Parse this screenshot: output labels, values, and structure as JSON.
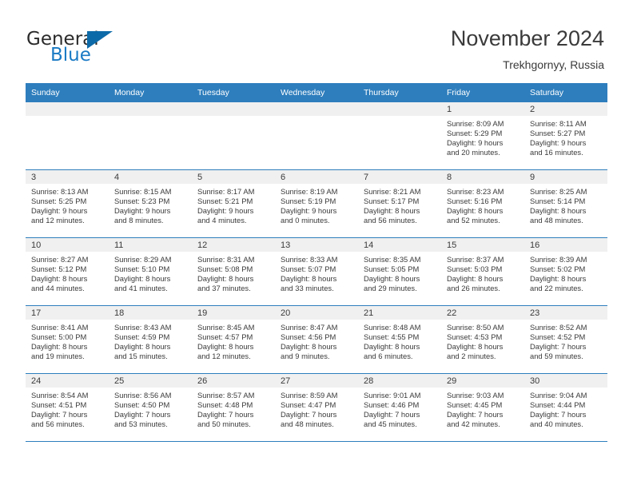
{
  "brand": {
    "word1": "General",
    "word2": "Blue",
    "accent_color": "#1a7ac4",
    "triangle_color": "#0d6aa8"
  },
  "header": {
    "title": "November 2024",
    "subtitle": "Trekhgornyy, Russia"
  },
  "calendar": {
    "header_color": "#2e7ebd",
    "daynum_band_color": "#f0f0f0",
    "weekdays": [
      "Sunday",
      "Monday",
      "Tuesday",
      "Wednesday",
      "Thursday",
      "Friday",
      "Saturday"
    ],
    "weeks": [
      [
        {
          "day": "",
          "sunrise": "",
          "sunset": "",
          "daylight1": "",
          "daylight2": "",
          "empty": true
        },
        {
          "day": "",
          "sunrise": "",
          "sunset": "",
          "daylight1": "",
          "daylight2": "",
          "empty": true
        },
        {
          "day": "",
          "sunrise": "",
          "sunset": "",
          "daylight1": "",
          "daylight2": "",
          "empty": true
        },
        {
          "day": "",
          "sunrise": "",
          "sunset": "",
          "daylight1": "",
          "daylight2": "",
          "empty": true
        },
        {
          "day": "",
          "sunrise": "",
          "sunset": "",
          "daylight1": "",
          "daylight2": "",
          "empty": true
        },
        {
          "day": "1",
          "sunrise": "Sunrise: 8:09 AM",
          "sunset": "Sunset: 5:29 PM",
          "daylight1": "Daylight: 9 hours",
          "daylight2": "and 20 minutes."
        },
        {
          "day": "2",
          "sunrise": "Sunrise: 8:11 AM",
          "sunset": "Sunset: 5:27 PM",
          "daylight1": "Daylight: 9 hours",
          "daylight2": "and 16 minutes."
        }
      ],
      [
        {
          "day": "3",
          "sunrise": "Sunrise: 8:13 AM",
          "sunset": "Sunset: 5:25 PM",
          "daylight1": "Daylight: 9 hours",
          "daylight2": "and 12 minutes."
        },
        {
          "day": "4",
          "sunrise": "Sunrise: 8:15 AM",
          "sunset": "Sunset: 5:23 PM",
          "daylight1": "Daylight: 9 hours",
          "daylight2": "and 8 minutes."
        },
        {
          "day": "5",
          "sunrise": "Sunrise: 8:17 AM",
          "sunset": "Sunset: 5:21 PM",
          "daylight1": "Daylight: 9 hours",
          "daylight2": "and 4 minutes."
        },
        {
          "day": "6",
          "sunrise": "Sunrise: 8:19 AM",
          "sunset": "Sunset: 5:19 PM",
          "daylight1": "Daylight: 9 hours",
          "daylight2": "and 0 minutes."
        },
        {
          "day": "7",
          "sunrise": "Sunrise: 8:21 AM",
          "sunset": "Sunset: 5:17 PM",
          "daylight1": "Daylight: 8 hours",
          "daylight2": "and 56 minutes."
        },
        {
          "day": "8",
          "sunrise": "Sunrise: 8:23 AM",
          "sunset": "Sunset: 5:16 PM",
          "daylight1": "Daylight: 8 hours",
          "daylight2": "and 52 minutes."
        },
        {
          "day": "9",
          "sunrise": "Sunrise: 8:25 AM",
          "sunset": "Sunset: 5:14 PM",
          "daylight1": "Daylight: 8 hours",
          "daylight2": "and 48 minutes."
        }
      ],
      [
        {
          "day": "10",
          "sunrise": "Sunrise: 8:27 AM",
          "sunset": "Sunset: 5:12 PM",
          "daylight1": "Daylight: 8 hours",
          "daylight2": "and 44 minutes."
        },
        {
          "day": "11",
          "sunrise": "Sunrise: 8:29 AM",
          "sunset": "Sunset: 5:10 PM",
          "daylight1": "Daylight: 8 hours",
          "daylight2": "and 41 minutes."
        },
        {
          "day": "12",
          "sunrise": "Sunrise: 8:31 AM",
          "sunset": "Sunset: 5:08 PM",
          "daylight1": "Daylight: 8 hours",
          "daylight2": "and 37 minutes."
        },
        {
          "day": "13",
          "sunrise": "Sunrise: 8:33 AM",
          "sunset": "Sunset: 5:07 PM",
          "daylight1": "Daylight: 8 hours",
          "daylight2": "and 33 minutes."
        },
        {
          "day": "14",
          "sunrise": "Sunrise: 8:35 AM",
          "sunset": "Sunset: 5:05 PM",
          "daylight1": "Daylight: 8 hours",
          "daylight2": "and 29 minutes."
        },
        {
          "day": "15",
          "sunrise": "Sunrise: 8:37 AM",
          "sunset": "Sunset: 5:03 PM",
          "daylight1": "Daylight: 8 hours",
          "daylight2": "and 26 minutes."
        },
        {
          "day": "16",
          "sunrise": "Sunrise: 8:39 AM",
          "sunset": "Sunset: 5:02 PM",
          "daylight1": "Daylight: 8 hours",
          "daylight2": "and 22 minutes."
        }
      ],
      [
        {
          "day": "17",
          "sunrise": "Sunrise: 8:41 AM",
          "sunset": "Sunset: 5:00 PM",
          "daylight1": "Daylight: 8 hours",
          "daylight2": "and 19 minutes."
        },
        {
          "day": "18",
          "sunrise": "Sunrise: 8:43 AM",
          "sunset": "Sunset: 4:59 PM",
          "daylight1": "Daylight: 8 hours",
          "daylight2": "and 15 minutes."
        },
        {
          "day": "19",
          "sunrise": "Sunrise: 8:45 AM",
          "sunset": "Sunset: 4:57 PM",
          "daylight1": "Daylight: 8 hours",
          "daylight2": "and 12 minutes."
        },
        {
          "day": "20",
          "sunrise": "Sunrise: 8:47 AM",
          "sunset": "Sunset: 4:56 PM",
          "daylight1": "Daylight: 8 hours",
          "daylight2": "and 9 minutes."
        },
        {
          "day": "21",
          "sunrise": "Sunrise: 8:48 AM",
          "sunset": "Sunset: 4:55 PM",
          "daylight1": "Daylight: 8 hours",
          "daylight2": "and 6 minutes."
        },
        {
          "day": "22",
          "sunrise": "Sunrise: 8:50 AM",
          "sunset": "Sunset: 4:53 PM",
          "daylight1": "Daylight: 8 hours",
          "daylight2": "and 2 minutes."
        },
        {
          "day": "23",
          "sunrise": "Sunrise: 8:52 AM",
          "sunset": "Sunset: 4:52 PM",
          "daylight1": "Daylight: 7 hours",
          "daylight2": "and 59 minutes."
        }
      ],
      [
        {
          "day": "24",
          "sunrise": "Sunrise: 8:54 AM",
          "sunset": "Sunset: 4:51 PM",
          "daylight1": "Daylight: 7 hours",
          "daylight2": "and 56 minutes."
        },
        {
          "day": "25",
          "sunrise": "Sunrise: 8:56 AM",
          "sunset": "Sunset: 4:50 PM",
          "daylight1": "Daylight: 7 hours",
          "daylight2": "and 53 minutes."
        },
        {
          "day": "26",
          "sunrise": "Sunrise: 8:57 AM",
          "sunset": "Sunset: 4:48 PM",
          "daylight1": "Daylight: 7 hours",
          "daylight2": "and 50 minutes."
        },
        {
          "day": "27",
          "sunrise": "Sunrise: 8:59 AM",
          "sunset": "Sunset: 4:47 PM",
          "daylight1": "Daylight: 7 hours",
          "daylight2": "and 48 minutes."
        },
        {
          "day": "28",
          "sunrise": "Sunrise: 9:01 AM",
          "sunset": "Sunset: 4:46 PM",
          "daylight1": "Daylight: 7 hours",
          "daylight2": "and 45 minutes."
        },
        {
          "day": "29",
          "sunrise": "Sunrise: 9:03 AM",
          "sunset": "Sunset: 4:45 PM",
          "daylight1": "Daylight: 7 hours",
          "daylight2": "and 42 minutes."
        },
        {
          "day": "30",
          "sunrise": "Sunrise: 9:04 AM",
          "sunset": "Sunset: 4:44 PM",
          "daylight1": "Daylight: 7 hours",
          "daylight2": "and 40 minutes."
        }
      ]
    ]
  }
}
